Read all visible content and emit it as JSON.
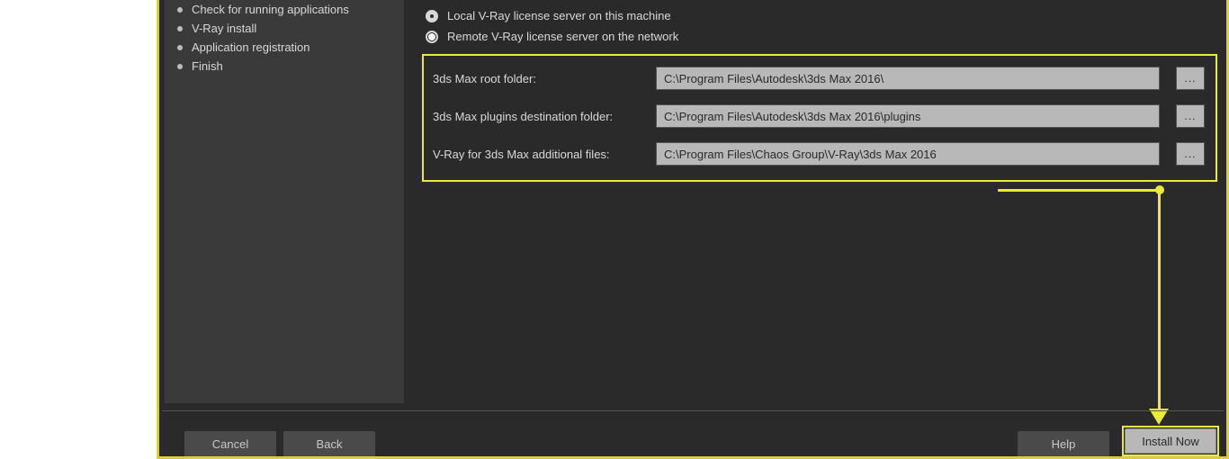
{
  "sidebar": {
    "items": [
      {
        "label": "Check for running applications"
      },
      {
        "label": "V-Ray install"
      },
      {
        "label": "Application registration"
      },
      {
        "label": "Finish"
      }
    ]
  },
  "license": {
    "local_label": "Local V-Ray license server on this machine",
    "remote_label": "Remote V-Ray license server on the network"
  },
  "paths": {
    "root_label": "3ds Max root folder:",
    "root_value": "C:\\Program Files\\Autodesk\\3ds Max 2016\\",
    "plugins_label": "3ds Max plugins destination folder:",
    "plugins_value": "C:\\Program Files\\Autodesk\\3ds Max 2016\\plugins",
    "additional_label": "V-Ray for 3ds Max additional files:",
    "additional_value": "C:\\Program Files\\Chaos Group\\V-Ray\\3ds Max 2016",
    "browse_label": "..."
  },
  "footer": {
    "cancel": "Cancel",
    "back": "Back",
    "help": "Help",
    "install": "Install Now"
  },
  "colors": {
    "highlight": "#eaea3a",
    "window_border": "#d9c94c",
    "panel": "#3a3a3a",
    "bg": "#2a2a2a",
    "input_bg": "#b8b8b8"
  }
}
